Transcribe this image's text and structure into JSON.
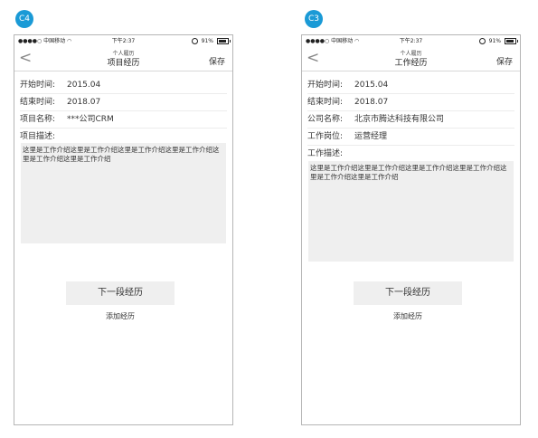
{
  "screens": [
    {
      "badge": "C4",
      "status": {
        "carrier": "中国移动",
        "time": "下午2:37",
        "battery": "91%"
      },
      "nav": {
        "subtitle": "个人履历",
        "title": "项目经历",
        "save_label": "保存",
        "back_icon": "chevron-left-icon"
      },
      "fields": [
        {
          "label": "开始时间:",
          "value": "2015.04"
        },
        {
          "label": "结束时间:",
          "value": "2018.07"
        },
        {
          "label": "项目名称:",
          "value": "***公司CRM"
        }
      ],
      "description_label": "项目描述:",
      "description_text": "这里是工作介绍这里是工作介绍这里是工作介绍这里是工作介绍这里是工作介绍这里是工作介绍",
      "next_button": "下一段经历",
      "add_link": "添加经历"
    },
    {
      "badge": "C3",
      "status": {
        "carrier": "中国移动",
        "time": "下午2:37",
        "battery": "91%"
      },
      "nav": {
        "subtitle": "个人履历",
        "title": "工作经历",
        "save_label": "保存",
        "back_icon": "chevron-left-icon"
      },
      "fields": [
        {
          "label": "开始时间:",
          "value": "2015.04"
        },
        {
          "label": "结束时间:",
          "value": "2018.07"
        },
        {
          "label": "公司名称:",
          "value": "北京市腾达科技有限公司"
        },
        {
          "label": "工作岗位:",
          "value": "运营经理"
        }
      ],
      "description_label": "工作描述:",
      "description_text": "这里是工作介绍这里是工作介绍这里是工作介绍这里是工作介绍这里是工作介绍这里是工作介绍",
      "next_button": "下一段经历",
      "add_link": "添加经历"
    }
  ],
  "colors": {
    "badge": "#1a9ad6",
    "panel": "#efefef",
    "border": "#b5b5b5"
  }
}
